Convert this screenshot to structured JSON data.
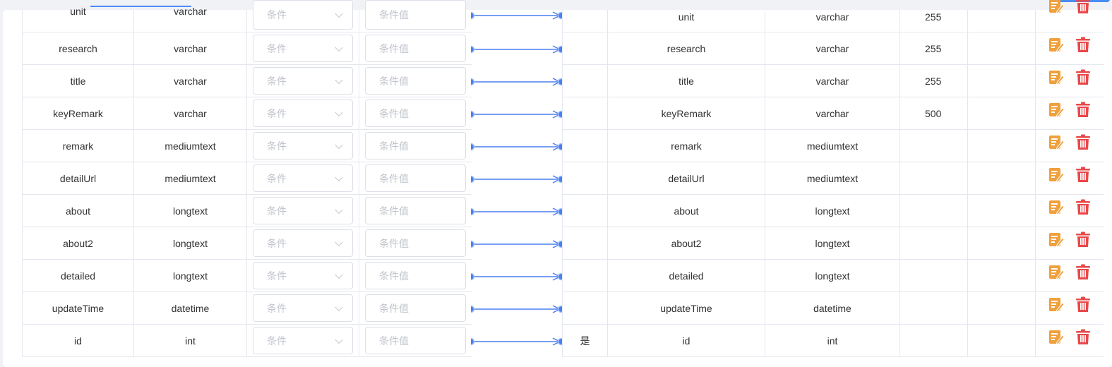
{
  "placeholders": {
    "condition": "条件",
    "condition_value": "条件值"
  },
  "rows": [
    {
      "source_field": "unit",
      "source_type": "varchar",
      "target_field": "unit",
      "target_type": "varchar",
      "length": "255",
      "primary_key": ""
    },
    {
      "source_field": "research",
      "source_type": "varchar",
      "target_field": "research",
      "target_type": "varchar",
      "length": "255",
      "primary_key": ""
    },
    {
      "source_field": "title",
      "source_type": "varchar",
      "target_field": "title",
      "target_type": "varchar",
      "length": "255",
      "primary_key": ""
    },
    {
      "source_field": "keyRemark",
      "source_type": "varchar",
      "target_field": "keyRemark",
      "target_type": "varchar",
      "length": "500",
      "primary_key": ""
    },
    {
      "source_field": "remark",
      "source_type": "mediumtext",
      "target_field": "remark",
      "target_type": "mediumtext",
      "length": "",
      "primary_key": ""
    },
    {
      "source_field": "detailUrl",
      "source_type": "mediumtext",
      "target_field": "detailUrl",
      "target_type": "mediumtext",
      "length": "",
      "primary_key": ""
    },
    {
      "source_field": "about",
      "source_type": "longtext",
      "target_field": "about",
      "target_type": "longtext",
      "length": "",
      "primary_key": ""
    },
    {
      "source_field": "about2",
      "source_type": "longtext",
      "target_field": "about2",
      "target_type": "longtext",
      "length": "",
      "primary_key": ""
    },
    {
      "source_field": "detailed",
      "source_type": "longtext",
      "target_field": "detailed",
      "target_type": "longtext",
      "length": "",
      "primary_key": ""
    },
    {
      "source_field": "updateTime",
      "source_type": "datetime",
      "target_field": "updateTime",
      "target_type": "datetime",
      "length": "",
      "primary_key": ""
    },
    {
      "source_field": "id",
      "source_type": "int",
      "target_field": "id",
      "target_type": "int",
      "length": "",
      "primary_key": "是"
    }
  ],
  "icons": {
    "edit": "edit-icon",
    "delete": "trash-icon"
  },
  "colors": {
    "connector": "#4a7ff0",
    "edit": "#f0a03c",
    "delete": "#e8484a",
    "accent": "#4a8cf7"
  }
}
